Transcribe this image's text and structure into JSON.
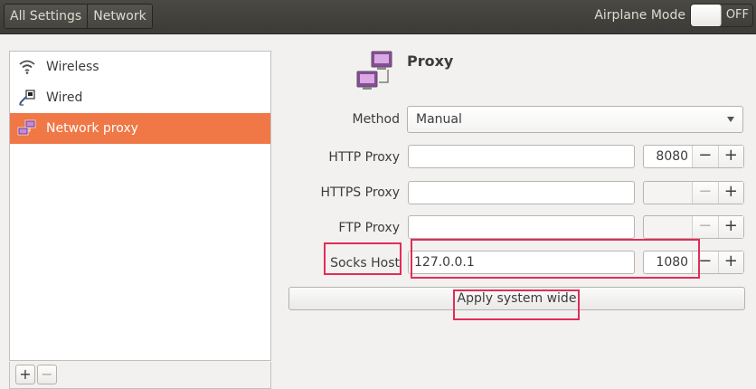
{
  "header": {
    "breadcrumbs": [
      "All Settings",
      "Network"
    ],
    "airplane_label": "Airplane Mode",
    "airplane_state": "OFF"
  },
  "sidebar": {
    "items": [
      {
        "label": "Wireless",
        "icon": "wifi-icon",
        "selected": false
      },
      {
        "label": "Wired",
        "icon": "wired-icon",
        "selected": false
      },
      {
        "label": "Network proxy",
        "icon": "network-proxy-icon",
        "selected": true
      }
    ],
    "add_label": "+",
    "remove_label": "−"
  },
  "proxy": {
    "title": "Proxy",
    "method_label": "Method",
    "method_value": "Manual",
    "rows": [
      {
        "label": "HTTP Proxy",
        "host": "",
        "port": "8080"
      },
      {
        "label": "HTTPS Proxy",
        "host": "",
        "port": ""
      },
      {
        "label": "FTP Proxy",
        "host": "",
        "port": ""
      },
      {
        "label": "Socks Host",
        "host": "127.0.0.1",
        "port": "1080"
      }
    ],
    "minus": "−",
    "plus": "+",
    "apply_label": "Apply system wide"
  },
  "colors": {
    "accent": "#f07746",
    "highlight": "#e32c57",
    "header_bg": "#3c3b37"
  }
}
